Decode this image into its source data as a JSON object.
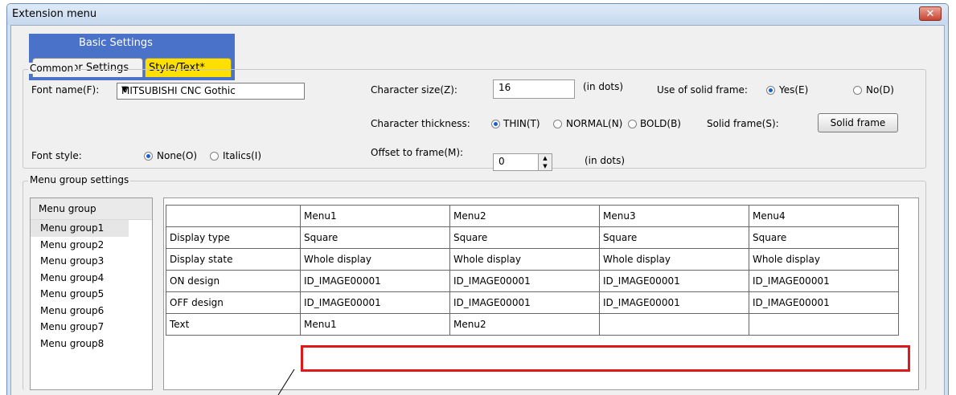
{
  "window": {
    "title": "Extension menu",
    "close_glyph": "✕"
  },
  "tabs": {
    "group_label": "Basic Settings",
    "behavior": "Behavior Settings",
    "style": "Style/Text*"
  },
  "common": {
    "legend": "Common",
    "font_name_label": "Font name(F):",
    "font_name_value": "MITSUBISHI CNC Gothic",
    "char_size_label": "Character size(Z):",
    "char_size_value": "16",
    "char_size_unit": "(in dots)",
    "solid_frame_use_label": "Use of solid frame:",
    "solid_yes": "Yes(E)",
    "solid_no": "No(D)",
    "thickness_label": "Character thickness:",
    "thin": "THIN(T)",
    "normal": "NORMAL(N)",
    "bold": "BOLD(B)",
    "solid_frame_label": "Solid frame(S):",
    "solid_frame_button": "Solid frame",
    "font_style_label": "Font style:",
    "none": "None(O)",
    "italics": "Italics(I)",
    "offset_label": "Offset to frame(M):",
    "offset_value": "0",
    "offset_unit": "(in dots)"
  },
  "menu_group": {
    "legend": "Menu group settings",
    "list_header": "Menu group",
    "items": [
      "Menu group1",
      "Menu group2",
      "Menu group3",
      "Menu group4",
      "Menu group5",
      "Menu group6",
      "Menu group7",
      "Menu group8"
    ],
    "table": {
      "headers": [
        "",
        "Menu1",
        "Menu2",
        "Menu3",
        "Menu4"
      ],
      "rows": [
        [
          "Display type",
          "Square",
          "Square",
          "Square",
          "Square"
        ],
        [
          "Display state",
          "Whole display",
          "Whole display",
          "Whole display",
          "Whole display"
        ],
        [
          "ON design",
          "ID_IMAGE00001",
          "ID_IMAGE00001",
          "ID_IMAGE00001",
          "ID_IMAGE00001"
        ],
        [
          "OFF design",
          "ID_IMAGE00001",
          "ID_IMAGE00001",
          "ID_IMAGE00001",
          "ID_IMAGE00001"
        ],
        [
          "Text",
          "Menu1",
          "Menu2",
          "",
          ""
        ]
      ]
    }
  },
  "colors": {
    "tab_group": "#4a72c8",
    "active_tab": "#ffe000",
    "highlight": "#e01818",
    "radio_selected": "#1a5fd0"
  }
}
